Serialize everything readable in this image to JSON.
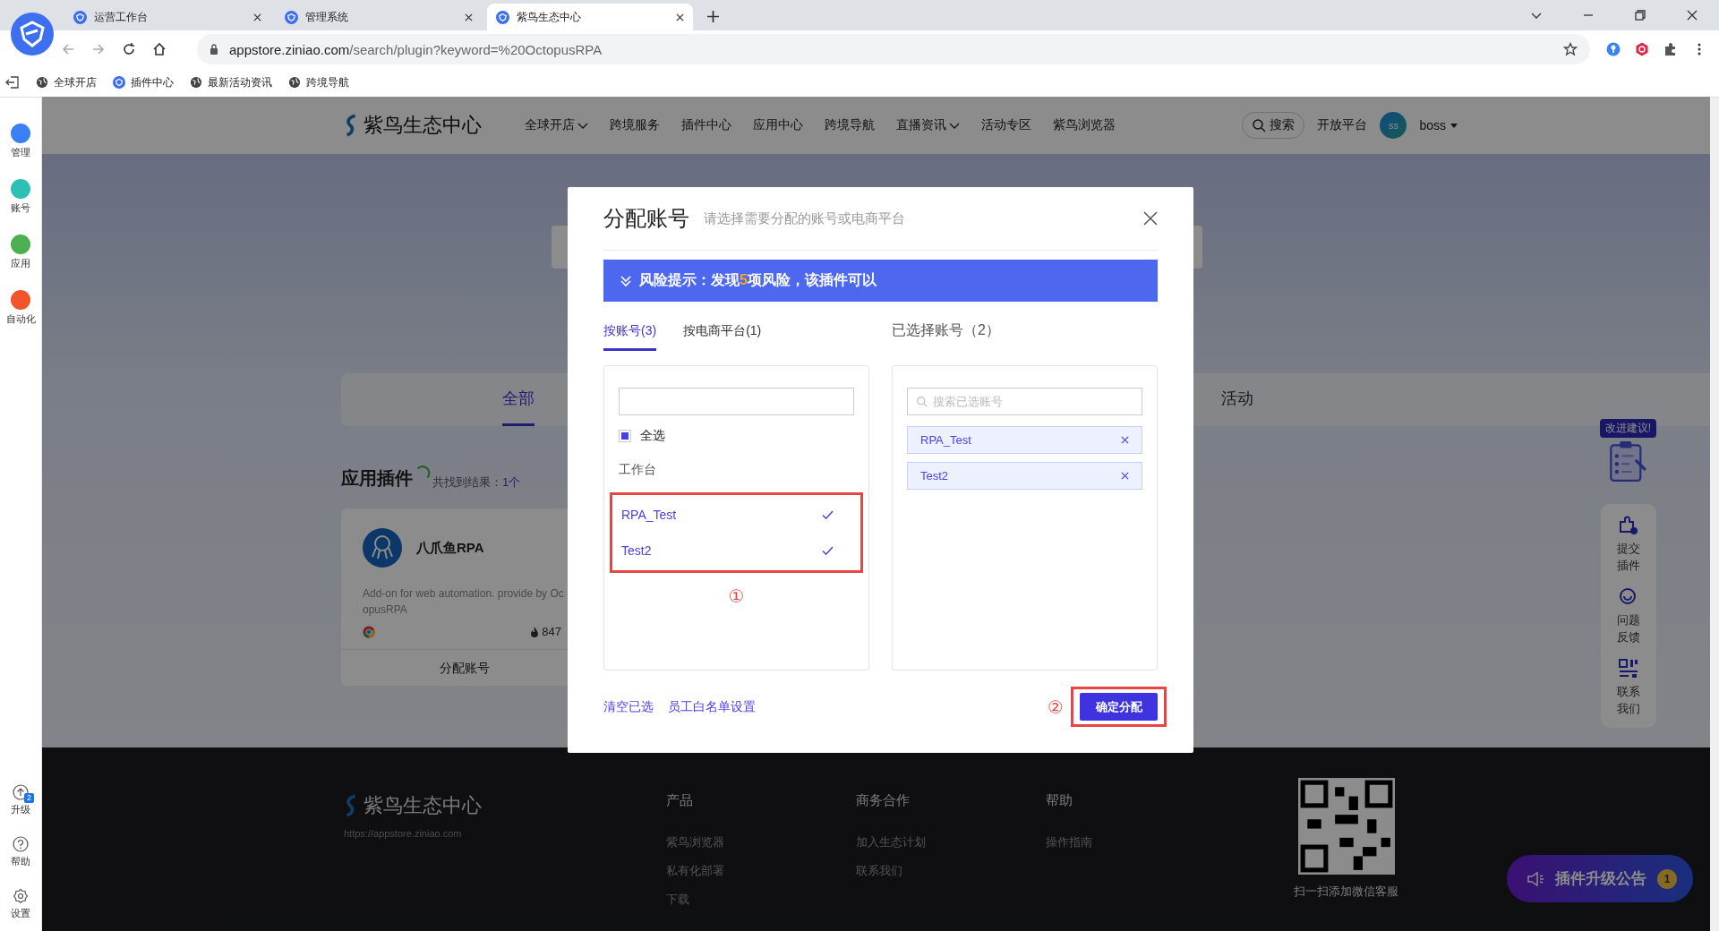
{
  "browser": {
    "tabs": [
      {
        "title": "运营工作台",
        "selected": false
      },
      {
        "title": "管理系统",
        "selected": false
      },
      {
        "title": "紫鸟生态中心",
        "selected": true
      }
    ],
    "url_host": "appstore.ziniao.com",
    "url_path": "/search/plugin?keyword=%20OctopusRPA",
    "bookmarks": [
      {
        "label": "全球开店",
        "kind": "globe"
      },
      {
        "label": "插件中心",
        "kind": "logo"
      },
      {
        "label": "最新活动资讯",
        "kind": "globe"
      },
      {
        "label": "跨境导航",
        "kind": "globe"
      }
    ]
  },
  "app_sidebar": {
    "top_items": [
      {
        "label": "管理",
        "color": "#3b7ff5"
      },
      {
        "label": "账号",
        "color": "#2fc0b5"
      },
      {
        "label": "应用",
        "color": "#4caf50"
      },
      {
        "label": "自动化",
        "color": "#f0552c"
      }
    ],
    "bottom_items": [
      {
        "label": "升级",
        "kind": "upgrade",
        "badge": "2"
      },
      {
        "label": "帮助",
        "kind": "help"
      },
      {
        "label": "设置",
        "kind": "settings"
      }
    ]
  },
  "page": {
    "logo": "紫鸟生态中心",
    "nav": [
      {
        "label": "全球开店",
        "dropdown": true
      },
      {
        "label": "跨境服务",
        "dropdown": false
      },
      {
        "label": "插件中心",
        "dropdown": false
      },
      {
        "label": "应用中心",
        "dropdown": false
      },
      {
        "label": "跨境导航",
        "dropdown": false
      },
      {
        "label": "直播资讯",
        "dropdown": true
      },
      {
        "label": "活动专区",
        "dropdown": false
      },
      {
        "label": "紫鸟浏览器",
        "dropdown": false
      }
    ],
    "search": "搜索",
    "open_platform": "开放平台",
    "avatar": "ss",
    "user": "boss",
    "categories": [
      {
        "label": "全部",
        "selected": true
      },
      {
        "label": "活动",
        "selected": false
      }
    ],
    "section_title": "应用插件",
    "result_label": "共找到结果：",
    "result_count": "1个",
    "plugin": {
      "name": "八爪鱼RPA",
      "description_lines": [
        "Add-on for web automation. provide by Oc",
        "opusRPA"
      ],
      "hot": "847",
      "action": "分配账号"
    },
    "suggestion": "改进建议!",
    "side_actions": [
      {
        "label": "提交插件",
        "kind": "puzzle"
      },
      {
        "label": "问题反馈",
        "kind": "chat"
      },
      {
        "label": "联系我们",
        "kind": "qr"
      }
    ],
    "footer": {
      "logo": "紫鸟生态中心",
      "url": "https://appstore.ziniao.com",
      "columns": [
        {
          "title": "产品",
          "links": [
            "紫鸟浏览器",
            "私有化部署",
            "下载"
          ]
        },
        {
          "title": "商务合作",
          "links": [
            "加入生态计划",
            "联系我们"
          ]
        },
        {
          "title": "帮助",
          "links": [
            "操作指南"
          ]
        }
      ],
      "qr_caption": "扫一扫添加微信客服"
    },
    "notice": {
      "label": "插件升级公告",
      "count": "1"
    }
  },
  "modal": {
    "title": "分配账号",
    "subtitle": "请选择需要分配的账号或电商平台",
    "banner": {
      "before": "风险提示：发现",
      "count": "5",
      "after": "项风险，该插件可以"
    },
    "tabs": [
      {
        "label": "按账号(3)",
        "selected": true
      },
      {
        "label": "按电商平台(1)",
        "selected": false
      }
    ],
    "selected_title": "已选择账号（2）",
    "select_all": {
      "label": "全选",
      "indeterminate": true
    },
    "group": "工作台",
    "accounts": [
      {
        "name": "RPA_Test",
        "checked": true
      },
      {
        "name": "Test2",
        "checked": true
      }
    ],
    "selected_search": {
      "placeholder": "搜索已选账号"
    },
    "selected_chips": [
      "RPA_Test",
      "Test2"
    ],
    "links": [
      "清空已选",
      "员工白名单设置"
    ],
    "confirm": "确定分配",
    "annotations": [
      "①",
      "②"
    ]
  }
}
